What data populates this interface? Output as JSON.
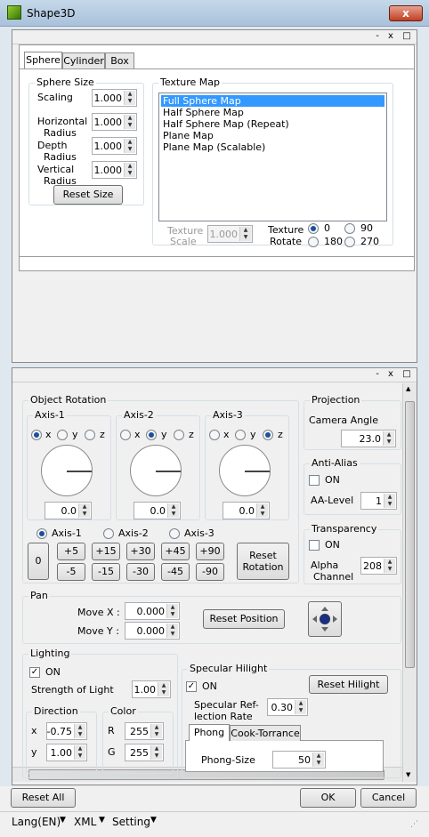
{
  "window": {
    "title": "Shape3D",
    "close": "x"
  },
  "panel_controls": {
    "minimize": "-",
    "close": "x",
    "maximize": "□"
  },
  "shape_tabs": [
    "Sphere",
    "Cylinder",
    "Box"
  ],
  "sphere_size": {
    "title": "Sphere Size",
    "scaling_label": "Scaling",
    "scaling": "1.000",
    "hradius_label1": "Horizontal",
    "hradius_label2": "Radius",
    "hradius": "1.000",
    "depth_label1": "Depth",
    "depth_label2": "Radius",
    "depth": "1.000",
    "vradius_label1": "Vertical",
    "vradius_label2": "Radius",
    "vradius": "1.000",
    "reset": "Reset Size"
  },
  "texture_map": {
    "title": "Texture Map",
    "items": [
      "Full Sphere Map",
      "Half Sphere Map",
      "Half Sphere Map (Repeat)",
      "Plane Map",
      "Plane Map (Scalable)"
    ],
    "selected": "Full Sphere Map",
    "scale_label1": "Texture",
    "scale_label2": "Scale",
    "scale": "1.000",
    "rotate_label1": "Texture",
    "rotate_label2": "Rotate",
    "rotate_options": [
      "0",
      "90",
      "180",
      "270"
    ],
    "rotate_selected": "0"
  },
  "object_rotation": {
    "title": "Object Rotation",
    "axis1": {
      "title": "Axis-1",
      "selected": "x",
      "value": "0.0"
    },
    "axis2": {
      "title": "Axis-2",
      "selected": "y",
      "value": "0.0"
    },
    "axis3": {
      "title": "Axis-3",
      "selected": "z",
      "value": "0.0"
    },
    "axis_letters": [
      "x",
      "y",
      "z"
    ],
    "axis_choices": [
      "Axis-1",
      "Axis-2",
      "Axis-3"
    ],
    "axis_selected": "Axis-1",
    "zero": "0",
    "steps_plus": [
      "+5",
      "+15",
      "+30",
      "+45",
      "+90"
    ],
    "steps_minus": [
      "-5",
      "-15",
      "-30",
      "-45",
      "-90"
    ],
    "reset": "Reset\nRotation"
  },
  "projection": {
    "title": "Projection",
    "camera_label": "Camera Angle",
    "camera": "23.0"
  },
  "antialias": {
    "title": "Anti-Alias",
    "on_label": "ON",
    "on": false,
    "level_label": "AA-Level",
    "level": "1"
  },
  "transparency": {
    "title": "Transparency",
    "on_label": "ON",
    "on": false,
    "alpha_label1": "Alpha",
    "alpha_label2": "Channel",
    "alpha": "208"
  },
  "pan": {
    "title": "Pan",
    "movex_label": "Move X :",
    "movex": "0.000",
    "movey_label": "Move Y :",
    "movey": "0.000",
    "reset": "Reset Position"
  },
  "lighting": {
    "title": "Lighting",
    "on_label": "ON",
    "on": true,
    "strength_label": "Strength of Light",
    "strength": "1.00",
    "direction_title": "Direction",
    "x_label": "x",
    "x": "-0.75",
    "y_label": "y",
    "y": "1.00",
    "color_title": "Color",
    "r_label": "R",
    "r": "255",
    "g_label": "G",
    "g": "255"
  },
  "specular": {
    "title": "Specular Hilight",
    "on_label": "ON",
    "on": true,
    "reset": "Reset Hilight",
    "rate_label1": "Specular Ref-",
    "rate_label2": "lection Rate",
    "rate": "0.30",
    "tabs": [
      "Phong",
      "Cook-Torrance"
    ],
    "phong_label": "Phong-Size",
    "phong": "50"
  },
  "footer": {
    "reset_all": "Reset All",
    "ok": "OK",
    "cancel": "Cancel"
  },
  "menu": {
    "lang": "Lang(EN)",
    "xml": "XML",
    "setting": "Setting"
  }
}
